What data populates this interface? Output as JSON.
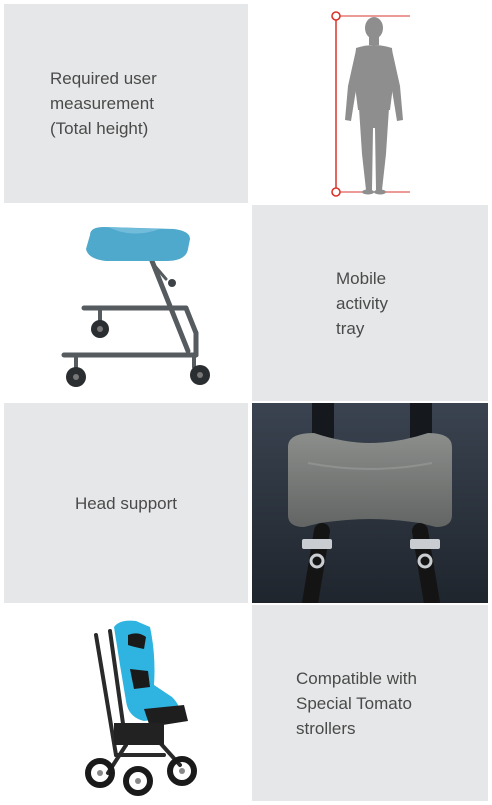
{
  "cells": {
    "measurement": {
      "lines": [
        "Required user",
        "measurement",
        "(Total height)"
      ]
    },
    "tray": {
      "lines": [
        "Mobile",
        "activity",
        "tray"
      ]
    },
    "head": {
      "lines": [
        "Head support"
      ]
    },
    "strollers": {
      "lines": [
        "Compatible with",
        "Special Tomato",
        "strollers"
      ]
    }
  },
  "colors": {
    "panel_gray": "#e6e7e8",
    "text": "#4a4a4a",
    "measure_line": "#d9342b",
    "tray_blue": "#4fa9cc",
    "stroller_blue": "#2fb3e0"
  },
  "icons": [
    "human-figure-icon",
    "height-measure-icon"
  ]
}
